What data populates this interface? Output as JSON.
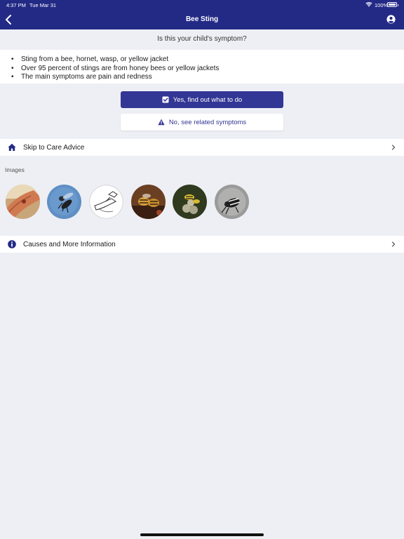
{
  "status": {
    "time": "4:37 PM",
    "date": "Tue Mar 31",
    "battery": "100%"
  },
  "navbar": {
    "title": "Bee Sting"
  },
  "question": "Is this your child's symptom?",
  "symptoms": [
    "Sting from a bee, hornet, wasp, or yellow jacket",
    "Over 95 percent of stings are from honey bees or yellow jackets",
    "The main symptoms are pain and redness"
  ],
  "buttons": {
    "yes": "Yes, find out what to do",
    "no": "No, see related symptoms"
  },
  "skip_row": {
    "label": "Skip to Care Advice"
  },
  "images": {
    "label": "Images"
  },
  "causes_row": {
    "label": "Causes and More Information"
  },
  "colors": {
    "primary": "#232a86",
    "button": "#323694",
    "background": "#eeeff4"
  }
}
